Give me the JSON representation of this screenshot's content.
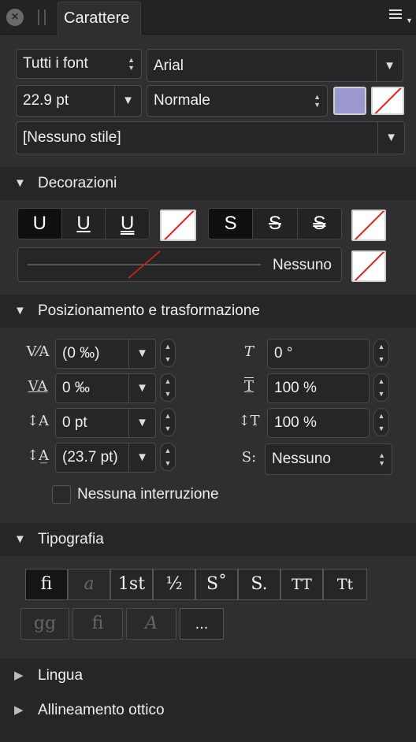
{
  "tab": {
    "title": "Carattere"
  },
  "font": {
    "collection": "Tutti i font",
    "family": "Arial",
    "size": "22.9 pt",
    "weight": "Normale",
    "style": "[Nessuno stile]",
    "fill_color": "#9b98cf"
  },
  "decorations": {
    "header": "Decorazioni",
    "underline_buttons": [
      "U",
      "U",
      "U"
    ],
    "strike_buttons": [
      "S",
      "S",
      "S"
    ],
    "line_label": "Nessuno"
  },
  "positioning": {
    "header": "Posizionamento e trasformazione",
    "kerning": "(0 ‰)",
    "tracking": "0 ‰",
    "baseline": "0 pt",
    "leading": "(23.7 pt)",
    "shear": "0 °",
    "horizontal_scale": "100 %",
    "vertical_scale": "100 %",
    "superscript_mode": "Nessuno",
    "no_break_label": "Nessuna interruzione"
  },
  "typography": {
    "header": "Tipografia",
    "row1": [
      "fi",
      "a",
      "1st",
      "½",
      "S˚",
      "S.",
      "TT",
      "Tt"
    ],
    "more": "..."
  },
  "sections": {
    "language": "Lingua",
    "optical_alignment": "Allineamento ottico"
  }
}
